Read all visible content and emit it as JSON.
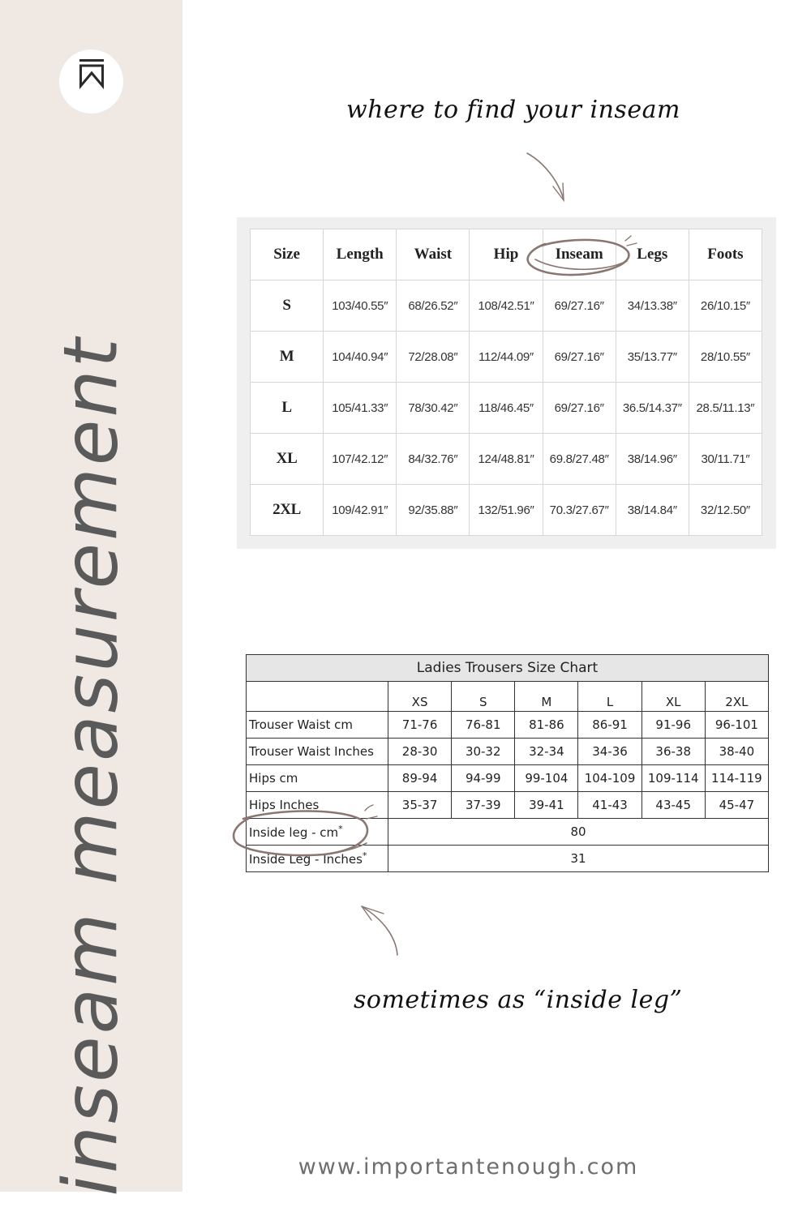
{
  "sidebar": {
    "logo_icon": "bookmark-w-icon",
    "vertical_title": "inseam measurement",
    "background": "#efe8e3"
  },
  "annotations": {
    "top_caption": "where to find your inseam",
    "bottom_caption": "sometimes as “inside leg”",
    "accent_color": "#8a7771"
  },
  "table1": {
    "headers": [
      "Size",
      "Length",
      "Waist",
      "Hip",
      "Inseam",
      "Legs",
      "Foots"
    ],
    "highlighted_header": "Inseam",
    "rows": [
      [
        "S",
        "103/40.55″",
        "68/26.52″",
        "108/42.51″",
        "69/27.16″",
        "34/13.38″",
        "26/10.15″"
      ],
      [
        "M",
        "104/40.94″",
        "72/28.08″",
        "112/44.09″",
        "69/27.16″",
        "35/13.77″",
        "28/10.55″"
      ],
      [
        "L",
        "105/41.33″",
        "78/30.42″",
        "118/46.45″",
        "69/27.16″",
        "36.5/14.37″",
        "28.5/11.13″"
      ],
      [
        "XL",
        "107/42.12″",
        "84/32.76″",
        "124/48.81″",
        "69.8/27.48″",
        "38/14.96″",
        "30/11.71″"
      ],
      [
        "2XL",
        "109/42.91″",
        "92/35.88″",
        "132/51.96″",
        "70.3/27.67″",
        "38/14.84″",
        "32/12.50″"
      ]
    ]
  },
  "table2": {
    "title": "Ladies Trousers Size Chart",
    "sizes": [
      "XS",
      "S",
      "M",
      "L",
      "XL",
      "2XL"
    ],
    "rows": [
      {
        "label": "Trouser Waist cm",
        "values": [
          "71-76",
          "76-81",
          "81-86",
          "86-91",
          "91-96",
          "96-101"
        ]
      },
      {
        "label": "Trouser Waist Inches",
        "values": [
          "28-30",
          "30-32",
          "32-34",
          "34-36",
          "36-38",
          "38-40"
        ]
      },
      {
        "label": "Hips cm",
        "values": [
          "89-94",
          "94-99",
          "99-104",
          "104-109",
          "109-114",
          "114-119"
        ]
      },
      {
        "label": "Hips Inches",
        "values": [
          "35-37",
          "37-39",
          "39-41",
          "41-43",
          "43-45",
          "45-47"
        ]
      }
    ],
    "merged_rows": [
      {
        "label": "Inside leg - cm",
        "mark": "*",
        "value": "80"
      },
      {
        "label": "Inside Leg - Inches",
        "mark": "*",
        "value": "31"
      }
    ],
    "highlighted_row": "Inside leg - cm"
  },
  "footer": {
    "url": "www.importantenough.com"
  }
}
